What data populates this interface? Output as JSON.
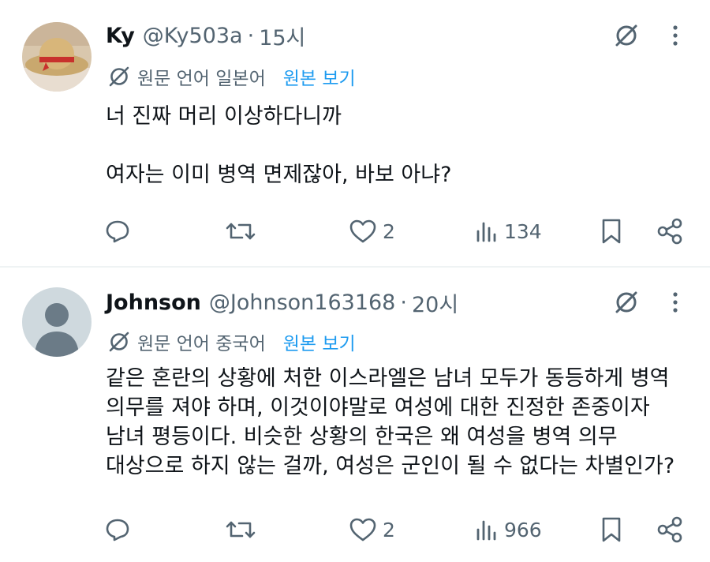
{
  "tweets": [
    {
      "author": {
        "name": "Ky",
        "handle": "@Ky503a"
      },
      "separator": "·",
      "time": "15시",
      "translation": {
        "note": "원문 언어 일본어",
        "show_original": "원본 보기"
      },
      "body": [
        "너 진짜 머리 이상하다니까",
        "",
        "여자는 이미 병역 면제잖아, 바보 아냐?"
      ],
      "stats": {
        "replies": "",
        "retweets": "",
        "likes": "2",
        "views": "134"
      }
    },
    {
      "author": {
        "name": "Johnson",
        "handle": "@Johnson163168"
      },
      "separator": "·",
      "time": "20시",
      "translation": {
        "note": "원문 언어 중국어",
        "show_original": "원본 보기"
      },
      "body": [
        "같은 혼란의 상황에 처한 이스라엘은 남녀 모두가 동등하게 병역",
        "의무를 져야 하며, 이것이야말로 여성에 대한 진정한 존중이자",
        "남녀 평등이다. 비슷한 상황의 한국은 왜 여성을 병역 의무",
        "대상으로 하지 않는 걸까, 여성은 군인이 될 수 없다는 차별인가?"
      ],
      "stats": {
        "replies": "",
        "retweets": "",
        "likes": "2",
        "views": "966"
      }
    }
  ],
  "icons": {
    "grok": "grok-icon",
    "more": "more-icon",
    "translate": "translate-icon",
    "reply": "reply-icon",
    "retweet": "retweet-icon",
    "like": "heart-icon",
    "views": "views-icon",
    "bookmark": "bookmark-icon",
    "share": "share-icon"
  },
  "colors": {
    "text": "#0f1419",
    "secondary": "#536471",
    "link": "#1d9bf0",
    "divider": "#eff3f4"
  }
}
